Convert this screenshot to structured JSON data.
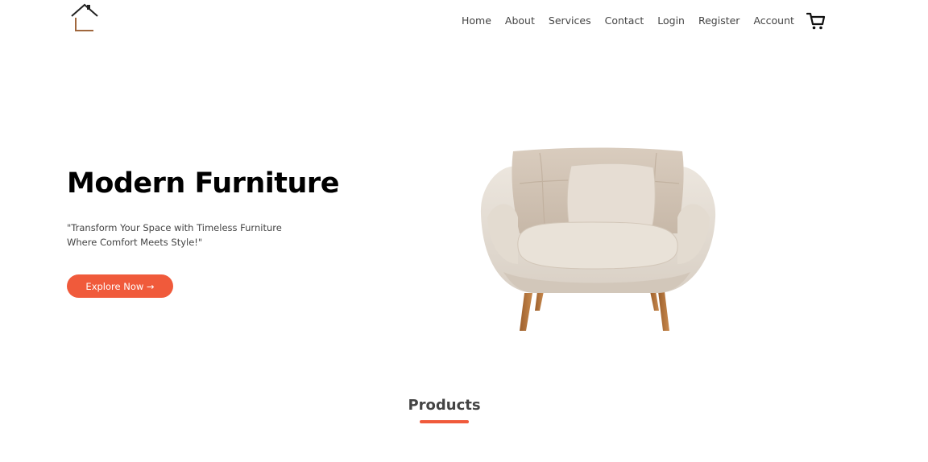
{
  "header": {
    "logo_icon": "house-icon",
    "nav": {
      "home": "Home",
      "about": "About",
      "services": "Services",
      "contact": "Contact",
      "login": "Login",
      "register": "Register",
      "account": "Account"
    },
    "cart_icon": "cart-icon"
  },
  "hero": {
    "title": "Modern Furniture",
    "subtitle": "\"Transform Your Space with Timeless Furniture Where Comfort Meets Style!\"",
    "button_label": "Explore Now →",
    "image": "armchair-image"
  },
  "products": {
    "title": "Products"
  },
  "colors": {
    "accent": "#f05a3b",
    "text_dark": "#000000",
    "text_muted": "#444444"
  }
}
